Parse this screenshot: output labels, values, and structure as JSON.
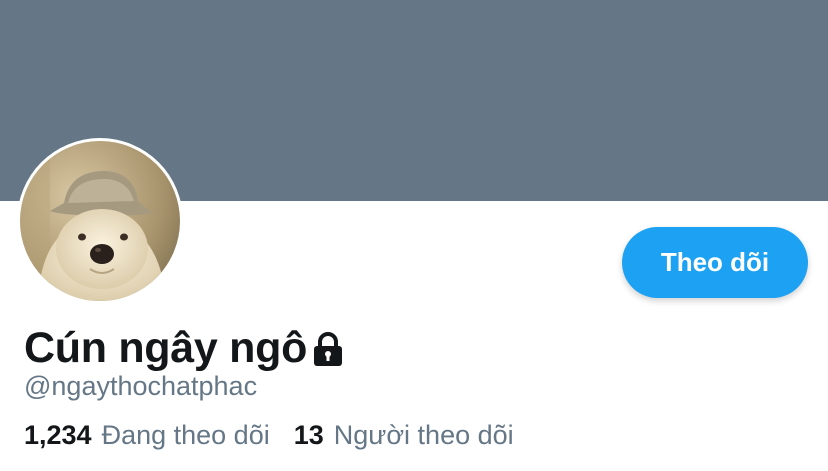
{
  "colors": {
    "banner": "#657786",
    "accent": "#1da1f2",
    "text_primary": "#14171a",
    "text_secondary": "#657786"
  },
  "profile": {
    "display_name": "Cún ngây ngô",
    "handle": "@ngaythochatphac",
    "protected_icon": "lock-icon",
    "avatar_icon": "dog-avatar"
  },
  "actions": {
    "follow_label": "Theo dõi"
  },
  "stats": {
    "following_count": "1,234",
    "following_label": "Đang theo dõi",
    "followers_count": "13",
    "followers_label": "Người theo dõi"
  }
}
